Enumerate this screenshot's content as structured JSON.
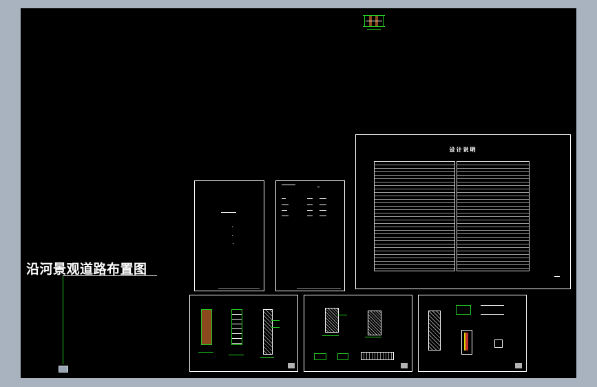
{
  "drawing": {
    "layout_title": "沿河景观道路布置图",
    "design_notes_heading": "设计说明"
  },
  "colors": {
    "workspace_background": "#a9b2bf",
    "model_space": "#000000",
    "sheet_border": "#ffffff",
    "annotation_green": "#22cc22",
    "accent_yellow": "#d8d800",
    "wood_brown": "#8a4a1e"
  },
  "sheets": [
    {
      "id": "cover"
    },
    {
      "id": "drawing-index"
    },
    {
      "id": "design-notes"
    },
    {
      "id": "detail-1"
    },
    {
      "id": "detail-2"
    },
    {
      "id": "detail-3"
    }
  ],
  "icons": {
    "viewport_marker": "ucs-marker-icon"
  }
}
